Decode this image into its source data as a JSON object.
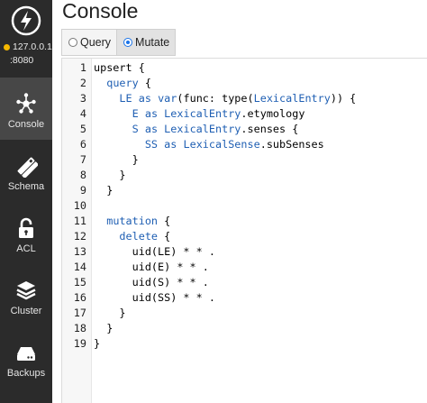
{
  "sidebar": {
    "server": {
      "host": "127.0.0.1",
      "port": ":8080",
      "status_color": "#f5b800"
    },
    "items": [
      {
        "label": "Console",
        "icon": "console-icon",
        "active": true
      },
      {
        "label": "Schema",
        "icon": "schema-icon",
        "active": false
      },
      {
        "label": "ACL",
        "icon": "lock-icon",
        "active": false
      },
      {
        "label": "Cluster",
        "icon": "layers-icon",
        "active": false
      },
      {
        "label": "Backups",
        "icon": "drive-icon",
        "active": false
      }
    ]
  },
  "main": {
    "title": "Console",
    "tabs": [
      {
        "label": "Query",
        "selected": false
      },
      {
        "label": "Mutate",
        "selected": true
      }
    ]
  },
  "editor": {
    "line_numbers": [
      "1",
      "2",
      "3",
      "4",
      "5",
      "6",
      "7",
      "8",
      "9",
      "10",
      "11",
      "12",
      "13",
      "14",
      "15",
      "16",
      "17",
      "18",
      "19"
    ],
    "lines": [
      "upsert {",
      "  query {",
      "    LE as var(func: type(LexicalEntry)) {",
      "      E as LexicalEntry.etymology",
      "      S as LexicalEntry.senses {",
      "        SS as LexicalSense.subSenses",
      "      }",
      "    }",
      "  }",
      "",
      "  mutation {",
      "    delete {",
      "      uid(LE) * * .",
      "      uid(E) * * .",
      "      uid(S) * * .",
      "      uid(SS) * * .",
      "    }",
      "  }",
      "}"
    ]
  },
  "colors": {
    "sidebar_bg": "#2b2b2b",
    "active_bg": "#474747",
    "keyword": "#1f5fb3",
    "accent": "#1a73e8"
  }
}
